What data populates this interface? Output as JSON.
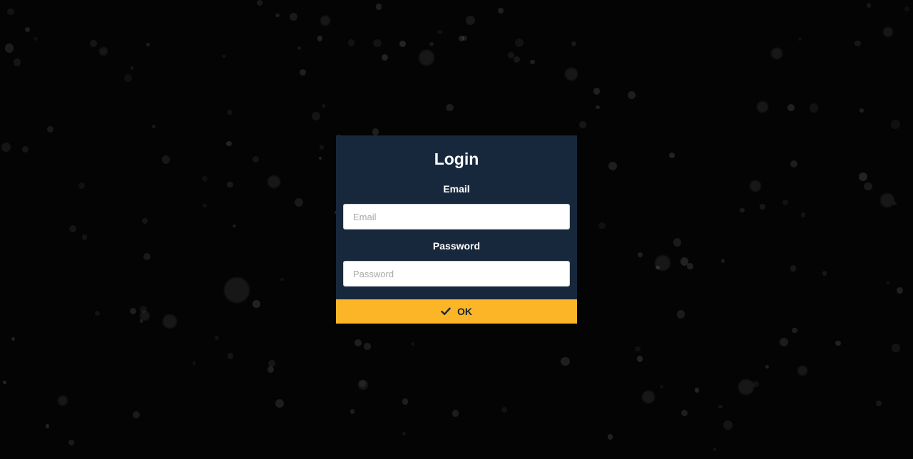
{
  "login": {
    "title": "Login",
    "email_label": "Email",
    "email_placeholder": "Email",
    "email_value": "",
    "password_label": "Password",
    "password_placeholder": "Password",
    "password_value": "",
    "ok_label": "OK",
    "ok_icon": "check-icon"
  },
  "colors": {
    "background": "#040404",
    "dialog": "#18283c",
    "accent": "#fbb527"
  }
}
